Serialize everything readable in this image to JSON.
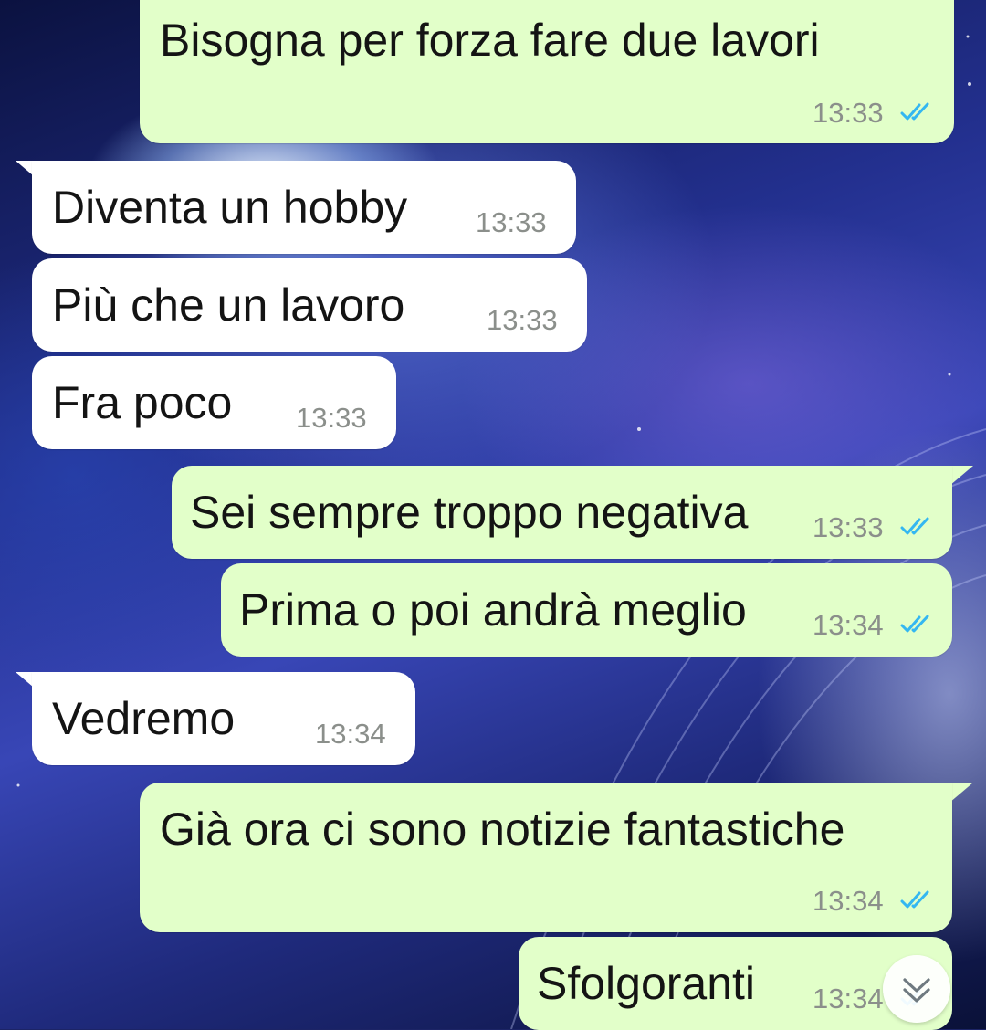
{
  "theme": {
    "incoming_bubble": "#ffffff",
    "outgoing_bubble": "#e2ffc9",
    "read_ticks": "#34b7f1",
    "time_text": "#8b8f8b"
  },
  "messages": [
    {
      "direction": "outgoing",
      "text": "Bisogna per forza fare due lavori",
      "time": "13:33",
      "status": "read"
    },
    {
      "direction": "incoming",
      "text": "Diventa un hobby",
      "time": "13:33"
    },
    {
      "direction": "incoming",
      "text": "Più che un lavoro",
      "time": "13:33"
    },
    {
      "direction": "incoming",
      "text": "Fra poco",
      "time": "13:33"
    },
    {
      "direction": "outgoing",
      "text": "Sei sempre troppo negativa",
      "time": "13:33",
      "status": "read"
    },
    {
      "direction": "outgoing",
      "text": "Prima o poi andrà meglio",
      "time": "13:34",
      "status": "read"
    },
    {
      "direction": "incoming",
      "text": "Vedremo",
      "time": "13:34"
    },
    {
      "direction": "outgoing",
      "text": "Già ora ci sono notizie fantastiche",
      "time": "13:34",
      "status": "read"
    },
    {
      "direction": "outgoing",
      "text": "Sfolgoranti",
      "time": "13:34",
      "status": "read"
    }
  ],
  "scroll_button": {
    "icon": "double-chevron-down-icon"
  }
}
